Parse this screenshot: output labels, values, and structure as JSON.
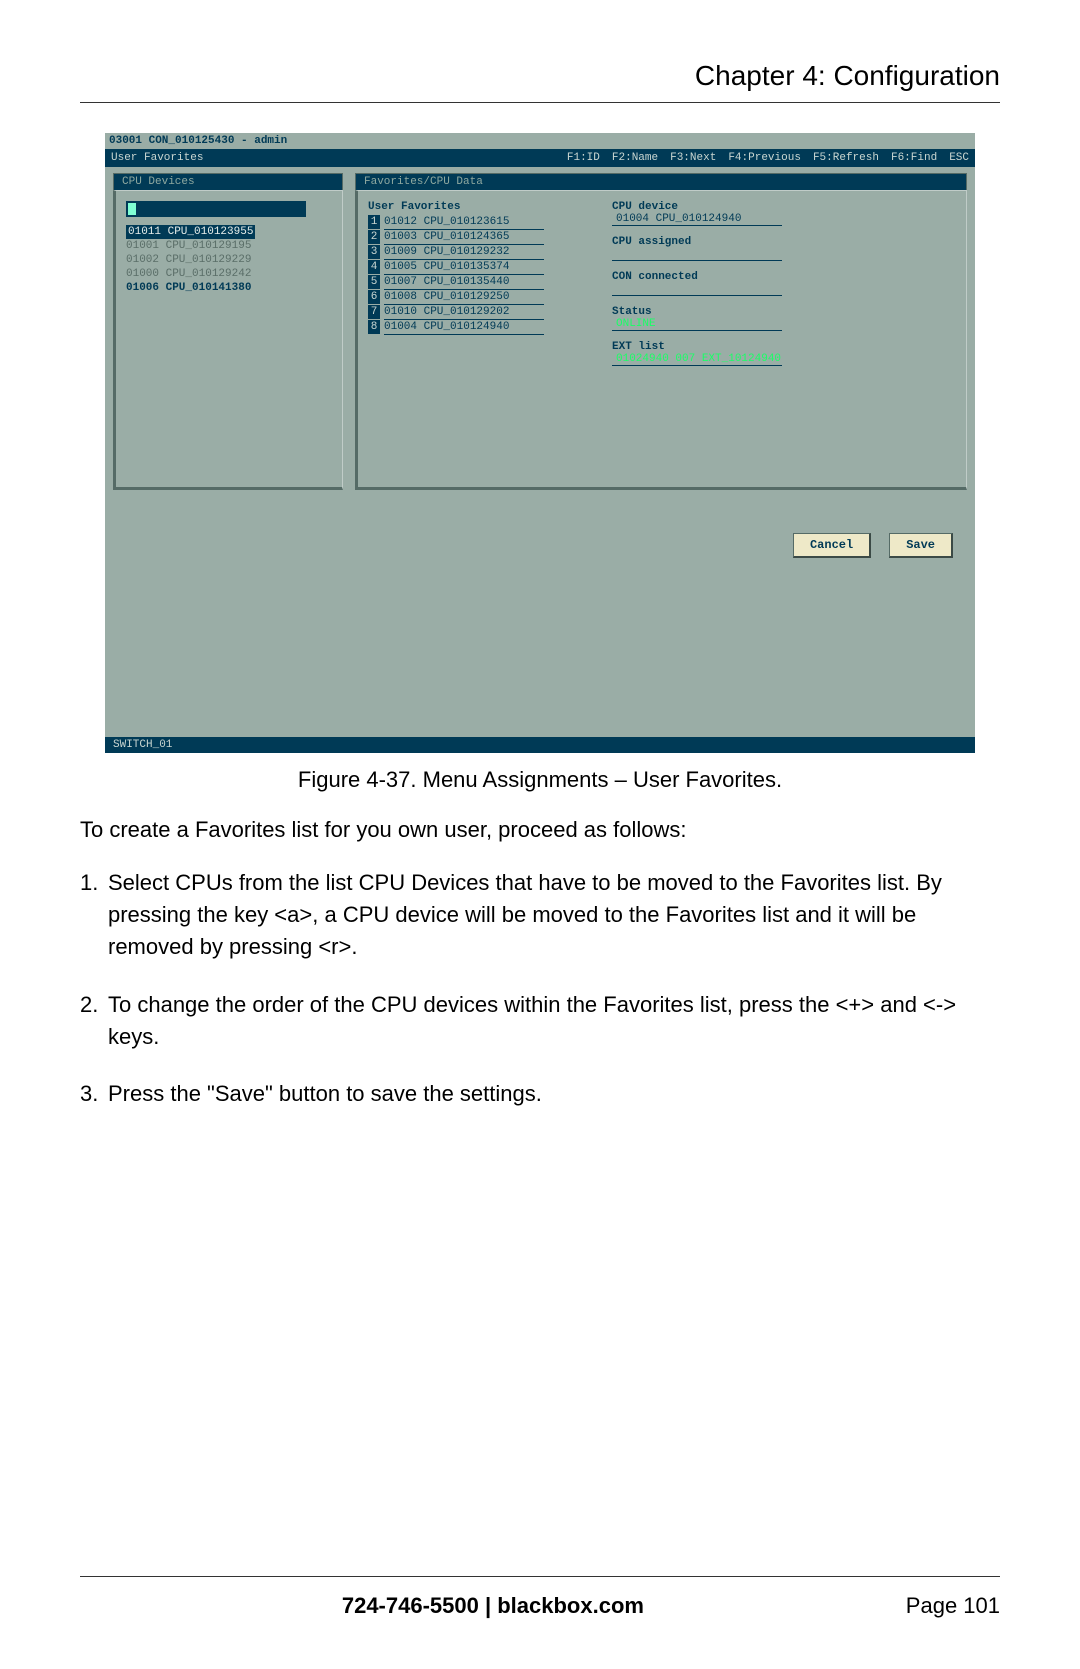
{
  "header": {
    "chapter": "Chapter 4: Configuration"
  },
  "terminal": {
    "top_line": "03001 CON_010125430 - admin",
    "menu_left": "User Favorites",
    "menu_keys": [
      "F1:ID",
      "F2:Name",
      "F3:Next",
      "F4:Previous",
      "F5:Refresh",
      "F6:Find",
      "ESC"
    ],
    "left_panel_title": "CPU Devices",
    "right_panel_title": "Favorites/CPU Data",
    "cpu_devices": [
      {
        "text": "01011 CPU_010123955",
        "state": "sel"
      },
      {
        "text": "01001 CPU_010129195",
        "state": "dim"
      },
      {
        "text": "01002 CPU_010129229",
        "state": "dim"
      },
      {
        "text": "01000 CPU_010129242",
        "state": "dim"
      },
      {
        "text": "01006 CPU_010141380",
        "state": "active"
      }
    ],
    "favorites_header": "User Favorites",
    "favorites": [
      {
        "n": "1",
        "text": "01012 CPU_010123615"
      },
      {
        "n": "2",
        "text": "01003 CPU_010124365"
      },
      {
        "n": "3",
        "text": "01009 CPU_010129232"
      },
      {
        "n": "4",
        "text": "01005 CPU_010135374"
      },
      {
        "n": "5",
        "text": "01007 CPU_010135440"
      },
      {
        "n": "6",
        "text": "01008 CPU_010129250"
      },
      {
        "n": "7",
        "text": "01010 CPU_010129202"
      },
      {
        "n": "8",
        "text": "01004 CPU_010124940"
      }
    ],
    "info": {
      "cpu_device_label": "CPU device",
      "cpu_device_value": "01004 CPU_010124940",
      "cpu_assigned_label": "CPU assigned",
      "con_connected_label": "CON connected",
      "status_label": "Status",
      "status_value": "ONLINE",
      "ext_list_label": "EXT list",
      "ext_list_value": "01024940 007 EXT_10124940"
    },
    "buttons": {
      "cancel": "Cancel",
      "save": "Save"
    },
    "footer": "SWITCH_01"
  },
  "caption": "Figure 4-37. Menu Assignments – User Favorites.",
  "intro": "To create a Favorites list for you own user, proceed as follows:",
  "steps": [
    "Select CPUs from the list CPU Devices that have to be moved to the Favorites list. By pressing the key <a>, a CPU device will be moved to the Favorites list and it will be removed by pressing <r>.",
    "To change the order of the CPU devices within the Favorites list, press the <+> and <-> keys.",
    "Press the \"Save\" button to save the settings."
  ],
  "footer": {
    "contact": "724-746-5500   |   blackbox.com",
    "page": "Page 101"
  }
}
